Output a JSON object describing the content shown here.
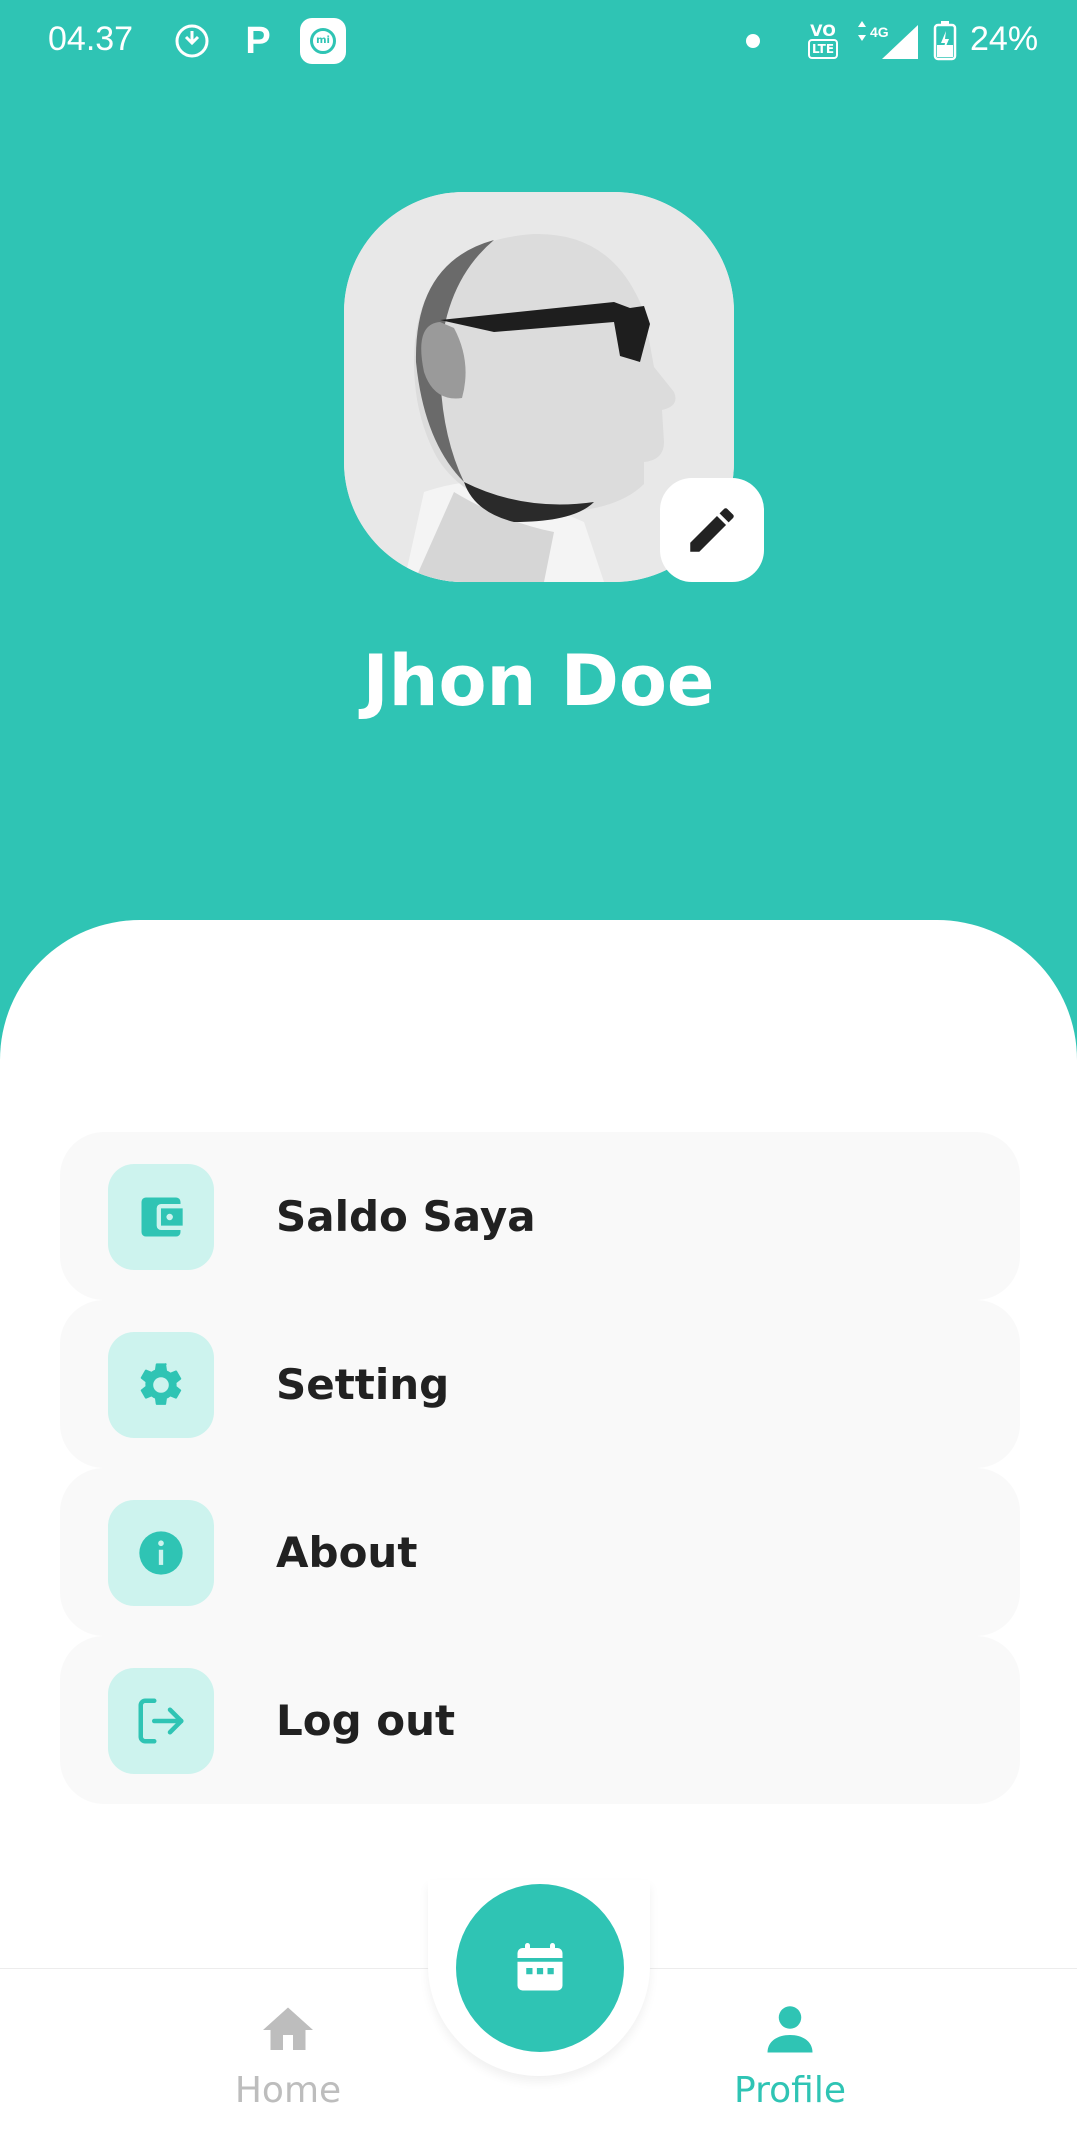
{
  "status_bar": {
    "time": "04.37",
    "p_icon": "P",
    "volte_top": "VO",
    "volte_bottom": "LTE",
    "network": "4G",
    "battery": "24%"
  },
  "profile": {
    "name": "Jhon Doe",
    "avatar_icon": "profile-photo",
    "edit_icon": "pencil-icon"
  },
  "menu": {
    "items": [
      {
        "label": "Saldo Saya",
        "icon": "wallet-icon"
      },
      {
        "label": "Setting",
        "icon": "gear-icon"
      },
      {
        "label": "About",
        "icon": "info-icon"
      },
      {
        "label": "Log out",
        "icon": "logout-icon"
      }
    ]
  },
  "bottom_nav": {
    "home_label": "Home",
    "profile_label": "Profile",
    "fab_icon": "calendar-icon",
    "active": "Profile"
  },
  "colors": {
    "accent": "#2fc4b4",
    "icon_bg": "#cdf3ee",
    "card_bg": "#f9f9f9",
    "inactive": "#bdbdbd"
  }
}
